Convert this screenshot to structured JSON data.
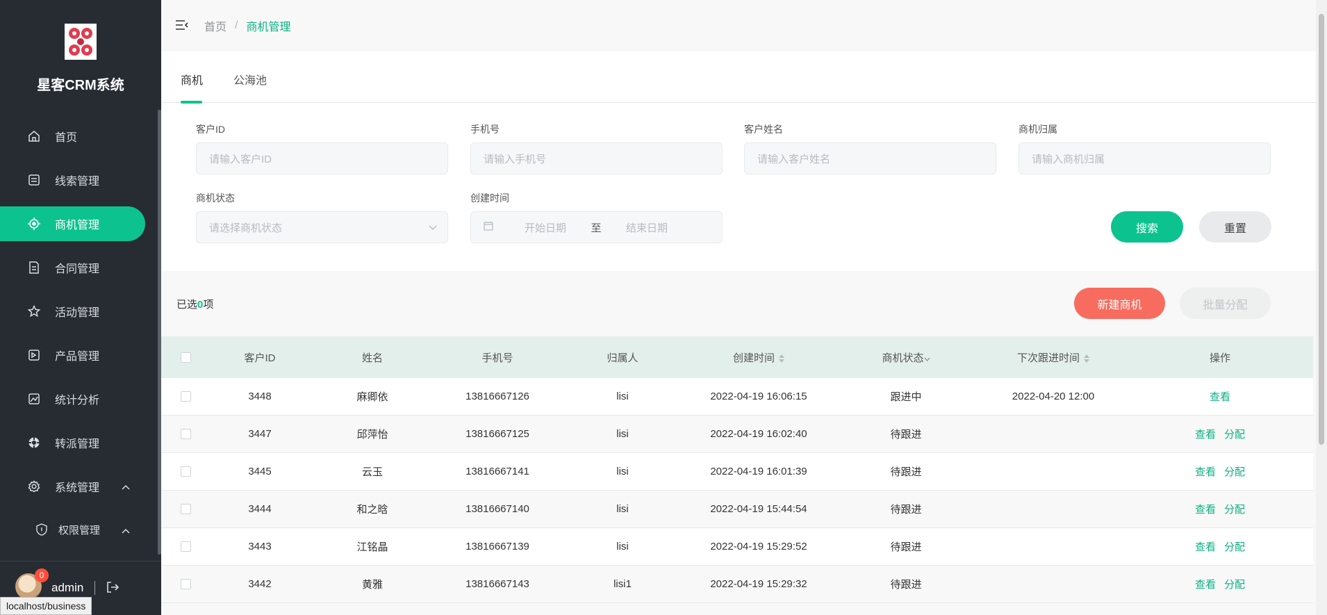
{
  "sidebar": {
    "app_title": "星客CRM系统",
    "items": [
      {
        "label": "首页",
        "icon": "home-icon"
      },
      {
        "label": "线索管理",
        "icon": "leads-icon"
      },
      {
        "label": "商机管理",
        "icon": "opportunity-icon",
        "active": true
      },
      {
        "label": "合同管理",
        "icon": "contract-icon"
      },
      {
        "label": "活动管理",
        "icon": "star-icon"
      },
      {
        "label": "产品管理",
        "icon": "product-icon"
      },
      {
        "label": "统计分析",
        "icon": "chart-icon"
      },
      {
        "label": "转派管理",
        "icon": "transfer-icon"
      },
      {
        "label": "系统管理",
        "icon": "gear-icon",
        "expanded": true
      }
    ],
    "sub_items": [
      {
        "label": "权限管理",
        "icon": "shield-icon",
        "expanded": true
      }
    ],
    "user": {
      "name": "admin",
      "badge": "0"
    },
    "status_url": "localhost/business"
  },
  "header": {
    "breadcrumb_home": "首页",
    "breadcrumb_sep": "/",
    "breadcrumb_current": "商机管理"
  },
  "tabs": [
    {
      "label": "商机",
      "active": true
    },
    {
      "label": "公海池",
      "active": false
    }
  ],
  "filters": {
    "customer_id": {
      "label": "客户ID",
      "placeholder": "请输入客户ID"
    },
    "phone": {
      "label": "手机号",
      "placeholder": "请输入手机号"
    },
    "customer_name": {
      "label": "客户姓名",
      "placeholder": "请输入客户姓名"
    },
    "owner": {
      "label": "商机归属",
      "placeholder": "请输入商机归属"
    },
    "status": {
      "label": "商机状态",
      "placeholder": "请选择商机状态"
    },
    "created": {
      "label": "创建时间",
      "start": "开始日期",
      "to": "至",
      "end": "结束日期"
    },
    "search_label": "搜索",
    "reset_label": "重置"
  },
  "toolbar": {
    "selected_prefix": "已选",
    "selected_count": "0",
    "selected_suffix": "项",
    "new_label": "新建商机",
    "batch_label": "批量分配"
  },
  "table": {
    "headers": [
      "客户ID",
      "姓名",
      "手机号",
      "归属人",
      "创建时间",
      "商机状态",
      "下次跟进时间",
      "操作"
    ],
    "rows": [
      {
        "id": "3448",
        "name": "麻卿依",
        "phone": "13816667126",
        "owner": "lisi",
        "created": "2022-04-19 16:06:15",
        "status": "跟进中",
        "next": "2022-04-20 12:00",
        "ops": [
          "查看"
        ]
      },
      {
        "id": "3447",
        "name": "邱萍怡",
        "phone": "13816667125",
        "owner": "lisi",
        "created": "2022-04-19 16:02:40",
        "status": "待跟进",
        "next": "",
        "ops": [
          "查看",
          "分配"
        ]
      },
      {
        "id": "3445",
        "name": "云玉",
        "phone": "13816667141",
        "owner": "lisi",
        "created": "2022-04-19 16:01:39",
        "status": "待跟进",
        "next": "",
        "ops": [
          "查看",
          "分配"
        ]
      },
      {
        "id": "3444",
        "name": "和之晗",
        "phone": "13816667140",
        "owner": "lisi",
        "created": "2022-04-19 15:44:54",
        "status": "待跟进",
        "next": "",
        "ops": [
          "查看",
          "分配"
        ]
      },
      {
        "id": "3443",
        "name": "江铭晶",
        "phone": "13816667139",
        "owner": "lisi",
        "created": "2022-04-19 15:29:52",
        "status": "待跟进",
        "next": "",
        "ops": [
          "查看",
          "分配"
        ]
      },
      {
        "id": "3442",
        "name": "黄雅",
        "phone": "13816667143",
        "owner": "lisi1",
        "created": "2022-04-19 15:29:32",
        "status": "待跟进",
        "next": "",
        "ops": [
          "查看",
          "分配"
        ]
      }
    ]
  },
  "colors": {
    "accent": "#0cc38f",
    "sidebar_bg": "#272c33",
    "danger_button": "#f76c5e",
    "table_header_bg": "#e3efeb"
  }
}
